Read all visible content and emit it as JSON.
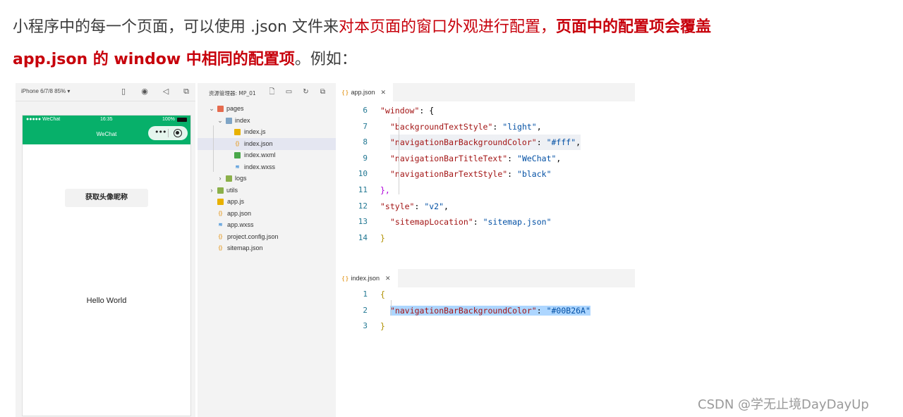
{
  "article": {
    "line1": {
      "plain": "小程序中的每一个页面，可以使用 .json 文件来",
      "red": "对本页面的窗口外观进行配置，",
      "red_bold": "页面中的配置项会覆盖"
    },
    "line2": {
      "red_bold": "app.json 的 window 中相同的配置项",
      "plain": "。例如："
    }
  },
  "simulator": {
    "device_label": "iPhone 6/7/8 85% ▾",
    "status_carrier": "●●●●● WeChat",
    "status_time": "16:35",
    "status_battery": "100%",
    "nav_title": "WeChat",
    "nav_bg": "#07b06a",
    "capsule_dots": "•••",
    "button_label": "获取头像昵称",
    "hello_text": "Hello World"
  },
  "explorer": {
    "title": "资源管理器: MP_01",
    "tree": [
      {
        "label": "pages",
        "type": "folder-pages",
        "expanded": true
      },
      {
        "label": "index",
        "type": "folder",
        "expanded": true
      },
      {
        "label": "index.js",
        "type": "js"
      },
      {
        "label": "index.json",
        "type": "json",
        "selected": true
      },
      {
        "label": "index.wxml",
        "type": "wxml"
      },
      {
        "label": "index.wxss",
        "type": "wxss"
      },
      {
        "label": "logs",
        "type": "folder-g",
        "expanded": false
      },
      {
        "label": "utils",
        "type": "folder-g",
        "expanded": false
      },
      {
        "label": "app.js",
        "type": "js"
      },
      {
        "label": "app.json",
        "type": "json"
      },
      {
        "label": "app.wxss",
        "type": "wxss"
      },
      {
        "label": "project.config.json",
        "type": "json"
      },
      {
        "label": "sitemap.json",
        "type": "json"
      }
    ]
  },
  "editor_app": {
    "tab_icon": "{ }",
    "tab_label": "app.json",
    "tab_close": "✕",
    "lines": [
      {
        "n": "6",
        "key": "\"window\"",
        "after": ": {"
      },
      {
        "n": "7",
        "key": "\"backgroundTextStyle\"",
        "val": "\"light\"",
        "tail": ","
      },
      {
        "n": "8",
        "key": "\"navigationBarBackgroundColor\"",
        "val": "\"#fff\"",
        "tail": ","
      },
      {
        "n": "9",
        "key": "\"navigationBarTitleText\"",
        "val": "\"WeChat\"",
        "tail": ","
      },
      {
        "n": "10",
        "key": "\"navigationBarTextStyle\"",
        "val": "\"black\"",
        "tail": ""
      },
      {
        "n": "11",
        "text": "},"
      },
      {
        "n": "12",
        "key": "\"style\"",
        "val": "\"v2\"",
        "tail": ","
      },
      {
        "n": "13",
        "key": "\"sitemapLocation\"",
        "val": "\"sitemap.json\"",
        "tail": ""
      },
      {
        "n": "14",
        "text": "}"
      }
    ]
  },
  "editor_index": {
    "tab_icon": "{ }",
    "tab_label": "index.json",
    "tab_close": "✕",
    "lines": [
      {
        "n": "1",
        "text": "{"
      },
      {
        "n": "2",
        "key": "\"navigationBarBackgroundColor\"",
        "val": "\"#00B26A\"",
        "tail": ""
      },
      {
        "n": "3",
        "text": "}"
      }
    ]
  },
  "watermark": "CSDN @学无止境DayDayUp",
  "colors": {
    "accent_red": "#c7000b",
    "wechat_green": "#07b06a",
    "selection": "#add6ff",
    "json_key": "#a31515",
    "json_value": "#0451a5"
  }
}
